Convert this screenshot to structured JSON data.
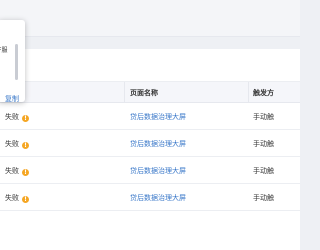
{
  "table": {
    "headers": [
      "页面名称",
      "触发方"
    ],
    "rows": [
      {
        "status": "失败",
        "page": "贷后数据治理大屏",
        "trigger": "手动触"
      },
      {
        "status": "失败",
        "page": "贷后数据治理大屏",
        "trigger": "手动触"
      },
      {
        "status": "失败",
        "page": "贷后数据治理大屏",
        "trigger": "手动触"
      },
      {
        "status": "失败",
        "page": "贷后数据治理大屏",
        "trigger": "手动触"
      }
    ]
  },
  "popover": {
    "text_line1": "F服",
    "text_line2": "",
    "copy_label": "复制"
  },
  "icons": {
    "warning": "warning-icon"
  },
  "colors": {
    "link": "#3a78c9",
    "warning": "#f5a623"
  }
}
